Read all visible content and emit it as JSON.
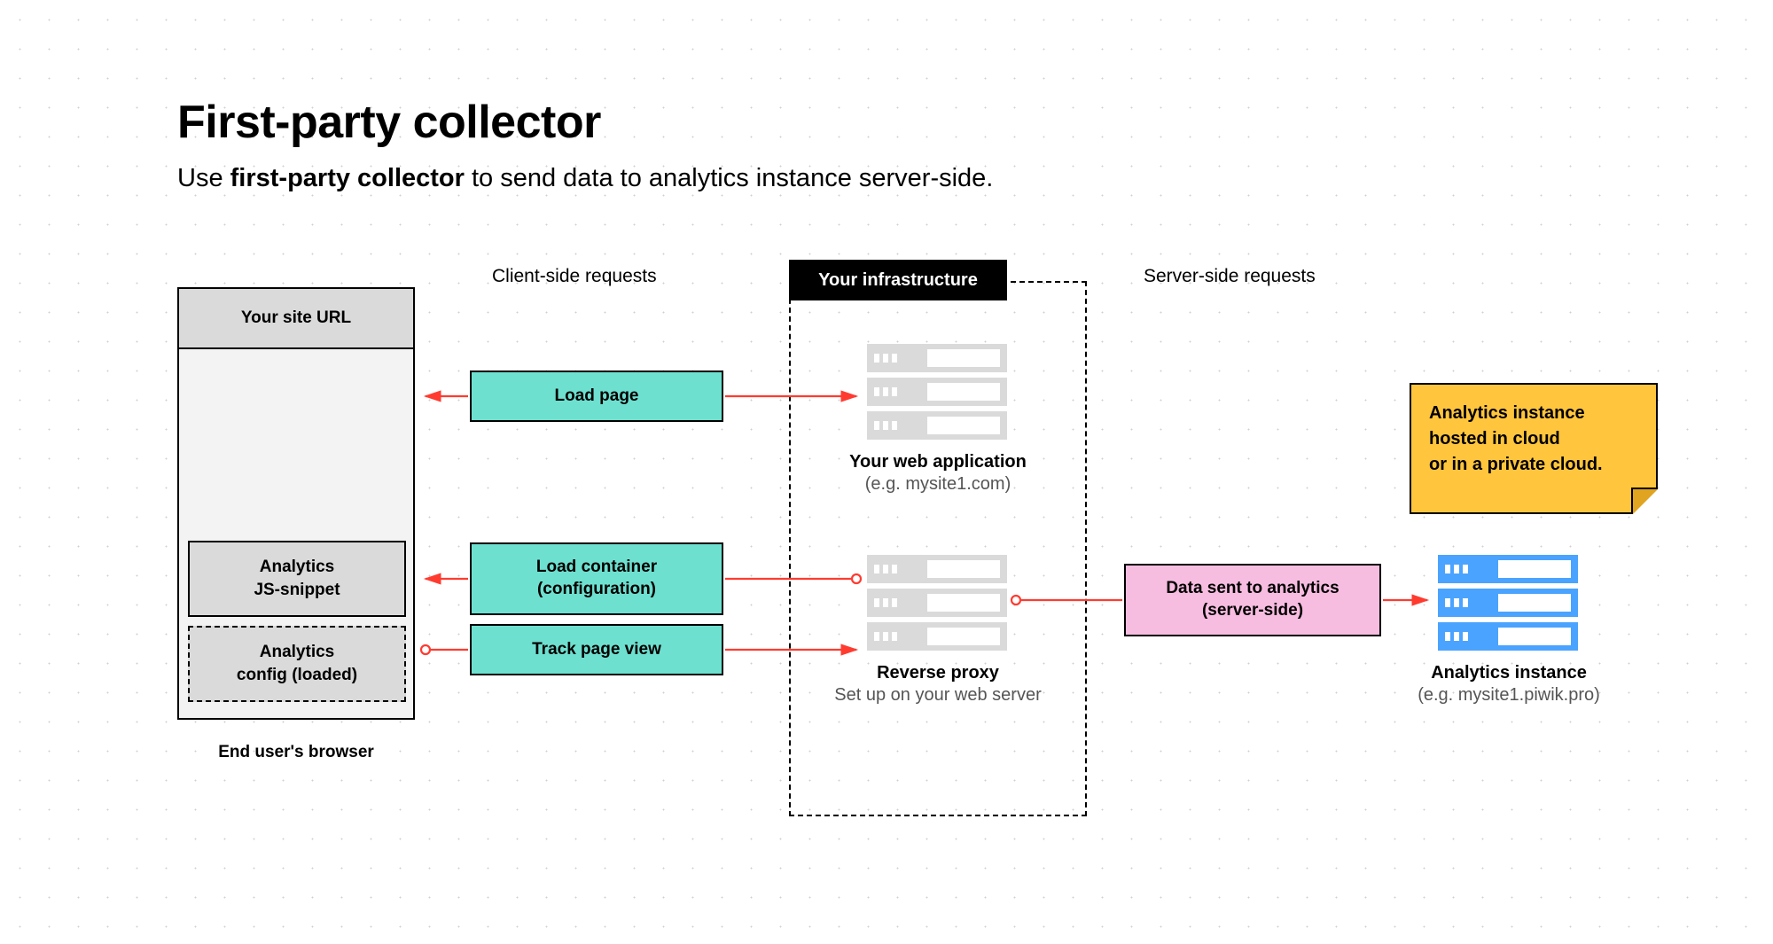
{
  "title": "First-party collector",
  "subtitle_prefix": "Use ",
  "subtitle_bold": "first-party collector",
  "subtitle_suffix": " to send data to analytics instance server-side.",
  "browser": {
    "url_bar": "Your site URL",
    "snippet1_line1": "Analytics",
    "snippet1_line2": "JS-snippet",
    "snippet2_line1": "Analytics",
    "snippet2_line2": "config (loaded)",
    "caption": "End user's browser"
  },
  "sections": {
    "client": "Client-side requests",
    "server": "Server-side requests"
  },
  "flows": {
    "load_page": "Load page",
    "load_container_l1": "Load container",
    "load_container_l2": "(configuration)",
    "track_page_view": "Track page view",
    "data_sent_l1": "Data sent to analytics",
    "data_sent_l2": "(server-side)"
  },
  "infra": {
    "badge": "Your infrastructure",
    "webapp_title": "Your web application",
    "webapp_sub": "(e.g. mysite1.com)",
    "proxy_title": "Reverse proxy",
    "proxy_sub": "Set up on your web server"
  },
  "note": {
    "l1": "Analytics instance",
    "l2": "hosted in cloud",
    "l3": "or in a private cloud."
  },
  "analytics": {
    "title": "Analytics instance",
    "sub": "(e.g. mysite1.piwik.pro)"
  }
}
